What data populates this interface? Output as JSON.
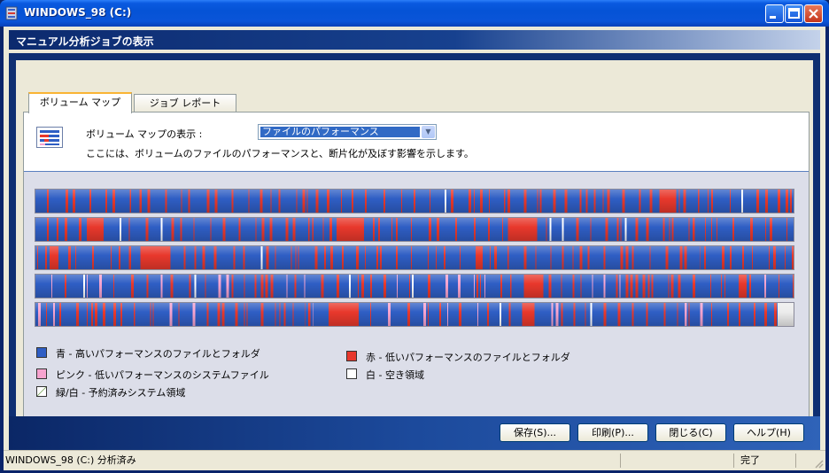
{
  "window": {
    "title": "WINDOWS_98 (C:)"
  },
  "header": {
    "title": "マニュアル分析ジョブの表示"
  },
  "tabs": [
    {
      "label": "ボリューム マップ"
    },
    {
      "label": "ジョブ レポート"
    }
  ],
  "volume_map": {
    "display_label": "ボリューム マップの表示 :",
    "select_value": "ファイルのパフォーマンス",
    "description": "ここには、ボリュームのファイルのパフォーマンスと、断片化が及ぼす影響を示します。"
  },
  "legend": [
    {
      "text": "青 - 高いパフォーマンスのファイルとフォルダ",
      "color": "#2f5ec4"
    },
    {
      "text": "赤 - 低いパフォーマンスのファイルとフォルダ",
      "color": "#e8382c"
    },
    {
      "text": "ピンク - 低いパフォーマンスのシステムファイル",
      "color": "#f7a3cf"
    },
    {
      "text": "白 - 空き領域",
      "color": "#ffffff"
    },
    {
      "text": "緑/白 - 予約済みシステム領域",
      "color": "#d8f0c8"
    }
  ],
  "buttons": {
    "save": "保存(S)...",
    "print": "印刷(P)...",
    "close": "閉じる(C)",
    "help": "ヘルプ(H)"
  },
  "status": {
    "left": "WINDOWS_98 (C:) 分析済み",
    "right": "完了"
  },
  "colors": {
    "blue": "#2f5ec4",
    "red": "#e8382c",
    "pink": "#f7a3cf",
    "white": "#ffffff",
    "accent": "#0a246a"
  }
}
